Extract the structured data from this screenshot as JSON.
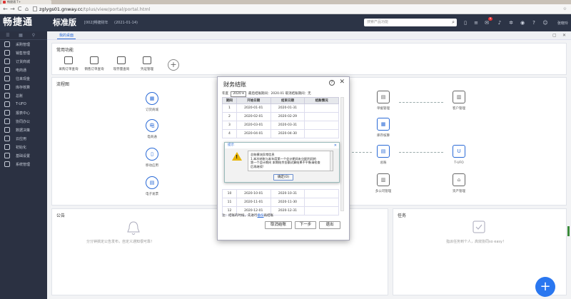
{
  "browser": {
    "tab_title": "畅捷通 T+",
    "url_domain": "zglygs01.gnway.cc",
    "url_path": "/tplus/view/portal/portal.html",
    "star": "☆"
  },
  "app": {
    "logo": "畅捷通",
    "edition": "标准版",
    "account": "[002]畅捷财年",
    "date": "(2021-01-14)",
    "search_placeholder": "搜索产品功能",
    "badge_count": "9",
    "user": "张晓玲",
    "accent_color": "#2a6ad6"
  },
  "sidebar": {
    "items": [
      {
        "label": "采购管理"
      },
      {
        "label": "销售管理"
      },
      {
        "label": "订货商城"
      },
      {
        "label": "电商通"
      },
      {
        "label": "往来现金"
      },
      {
        "label": "库存核算"
      },
      {
        "label": "总账"
      },
      {
        "label": "T-UFO"
      },
      {
        "label": "报表中心"
      },
      {
        "label": "协同办公"
      },
      {
        "label": "数据决策"
      },
      {
        "label": "云应用"
      },
      {
        "label": "初始化"
      },
      {
        "label": "基础设置"
      },
      {
        "label": "系统管理"
      }
    ]
  },
  "tabs": {
    "active": "我的桌面"
  },
  "quick": {
    "title": "常用功能",
    "items": [
      {
        "label": "采购订单查询"
      },
      {
        "label": "销售订单查询"
      },
      {
        "label": "现存量查询"
      },
      {
        "label": "凭证管理"
      }
    ]
  },
  "flow": {
    "title": "流程图",
    "nodes": {
      "mall": "订货商城",
      "ec": "电商通",
      "pos": "移动应用",
      "fast": "电子发票",
      "doc": "单据管理",
      "cust": "客户管理",
      "stock": "库存核算",
      "gl": "总账",
      "ufo": "T-UFO",
      "fin": "多公司管理",
      "asset": "资产管理"
    }
  },
  "notice": {
    "title": "公告",
    "empty": "分分钟搞定公告发布，自定义通知很可靠！"
  },
  "task": {
    "title": "任务",
    "empty": "指派任务到个人，高效协同so easy！"
  },
  "dialog": {
    "title": "财务结账",
    "year_label": "年度",
    "year_value": "2020",
    "last_closed": "最后结账期间：2020.01",
    "last_unclosed": "取消结账期间：无",
    "headers": [
      "期间",
      "开始日期",
      "结束日期",
      "结账情况"
    ],
    "rows": [
      {
        "no": "1",
        "start": "2020-01-01",
        "end": "2020-01-31",
        "status": ""
      },
      {
        "no": "2",
        "start": "2020-02-01",
        "end": "2020-02-29",
        "status": ""
      },
      {
        "no": "3",
        "start": "2020-03-01",
        "end": "2020-03-31",
        "status": ""
      },
      {
        "no": "4",
        "start": "2020-04-01",
        "end": "2020-04-30",
        "status": ""
      },
      {
        "no": "10",
        "start": "2020-10-01",
        "end": "2020-10-31",
        "status": ""
      },
      {
        "no": "11",
        "start": "2020-11-01",
        "end": "2020-11-30",
        "status": ""
      },
      {
        "no": "12",
        "start": "2020-12-01",
        "end": "2020-12-31",
        "status": ""
      }
    ],
    "note_prefix": "注：结账的时候，先进行",
    "note_link": "备份",
    "note_suffix": "再结账",
    "btn_cancel": "取消结账",
    "btn_next": "下一步",
    "btn_exit": "退出"
  },
  "alert": {
    "title": "提示",
    "lines": [
      "总账模块异常信息",
      "1.本次结账与本年度第一个会计期间未分配利润的",
      "第一个会计期间 本期结余金额试算结果不平衡请检查",
      "后再继续!"
    ],
    "ok": "确定(O)"
  }
}
